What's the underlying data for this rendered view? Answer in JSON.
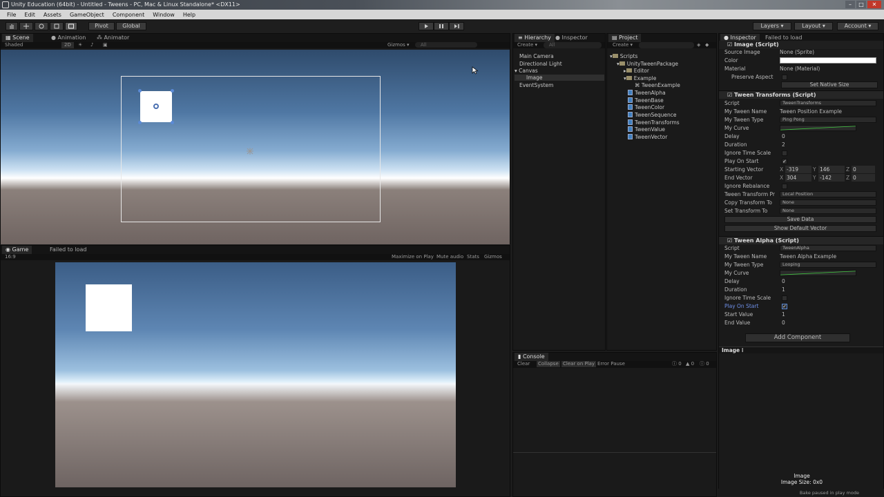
{
  "window": {
    "title": "Unity Education (64bit) - Untitled - Tweens - PC, Mac & Linux Standalone* <DX11>",
    "controls": [
      "–",
      "□",
      "✕"
    ]
  },
  "menu": [
    "File",
    "Edit",
    "Assets",
    "GameObject",
    "Component",
    "Window",
    "Help"
  ],
  "toolbar": {
    "pivot_label": "Pivot",
    "global_label": "Global",
    "layers_label": "Layers",
    "layout_label": "Layout",
    "account_label": "Account"
  },
  "scene": {
    "tabs": [
      "Scene",
      "Animation",
      "Animator"
    ],
    "shading": "Shaded",
    "mode_2d": "2D",
    "gizmos": "Gizmos",
    "search_placeholder": "All"
  },
  "game": {
    "tab": "Game",
    "status": "Failed to load",
    "aspect": "16:9",
    "options": [
      "Maximize on Play",
      "Mute audio",
      "Stats",
      "Gizmos"
    ]
  },
  "hierarchy": {
    "tabs": [
      "Hierarchy",
      "Inspector"
    ],
    "create_label": "Create",
    "search_placeholder": "All",
    "items": [
      "Main Camera",
      "Directional Light",
      "Canvas",
      "Image",
      "EventSystem"
    ]
  },
  "project": {
    "tab": "Project",
    "create_label": "Create",
    "root": "Scripts",
    "package": "UnityTweenPackage",
    "editor_folder": "Editor",
    "example_folder": "Example",
    "example_script": "TweenExample",
    "scripts": [
      "TweenAlpha",
      "TweenBase",
      "TweenColor",
      "TweenSequence",
      "TweenTransforms",
      "TweenValue",
      "TweenVector"
    ]
  },
  "console": {
    "tab": "Console",
    "buttons": [
      "Clear",
      "Collapse",
      "Clear on Play",
      "Error Pause"
    ],
    "counts": [
      "0",
      "0",
      "0"
    ]
  },
  "inspector": {
    "tabs": [
      "Inspector",
      "Failed to load"
    ],
    "image_script": {
      "title": "Image (Script)",
      "source_image_label": "Source Image",
      "source_image": "None (Sprite)",
      "color_label": "Color",
      "material_label": "Material",
      "material": "None (Material)",
      "preserve_aspect_label": "Preserve Aspect",
      "set_native_size": "Set Native Size"
    },
    "tween_transforms": {
      "title": "Tween Transforms (Script)",
      "script_label": "Script",
      "script": "TweenTransforms",
      "name_label": "My Tween Name",
      "name": "Tween Position Example",
      "type_label": "My Tween Type",
      "type": "Ping Pong",
      "curve_label": "My Curve",
      "delay_label": "Delay",
      "delay": "0",
      "duration_label": "Duration",
      "duration": "2",
      "ignore_label": "Ignore Time Scale",
      "play_label": "Play On Start",
      "start_vec_label": "Starting Vector",
      "start_x": "-319",
      "start_y": "146",
      "start_z": "0",
      "end_vec_label": "End Vector",
      "end_x": "304",
      "end_y": "-142",
      "end_z": "0",
      "rebalance_label": "Ignore Rebalance",
      "tween_tr_label": "Tween Transform Pr",
      "tween_tr": "Local Position",
      "copy_label": "Copy Transform To",
      "copy": "None",
      "set_label": "Set Transform To",
      "set": "None",
      "save_data": "Save Data",
      "show_default": "Show Default Vector"
    },
    "tween_alpha": {
      "title": "Tween Alpha (Script)",
      "script_label": "Script",
      "script": "TweenAlpha",
      "name_label": "My Tween Name",
      "name": "Tween Alpha Example",
      "type_label": "My Tween Type",
      "type": "Looping",
      "curve_label": "My Curve",
      "delay_label": "Delay",
      "delay": "0",
      "duration_label": "Duration",
      "duration": "1",
      "ignore_label": "Ignore Time Scale",
      "play_label": "Play On Start",
      "start_label": "Start Value",
      "start": "1",
      "end_label": "End Value",
      "end": "0"
    },
    "add_component": "Add Component",
    "preview_label": "Image",
    "preview_title": "Image",
    "preview_size": "Image Size: 0x0"
  },
  "statusbar": {
    "text": "Bake paused in play mode"
  },
  "colors": {
    "accent_blue": "#5b8ad6",
    "curve_green": "#3fc23f",
    "sky_top": "#2f4b6c",
    "ground": "#6f6461"
  }
}
